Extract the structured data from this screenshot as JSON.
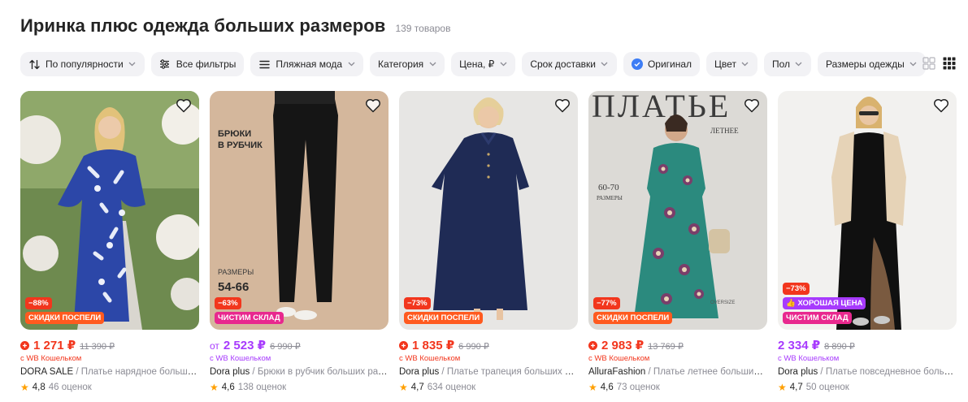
{
  "header": {
    "title": "Иринка плюс одежда больших размеров",
    "count": "139 товаров"
  },
  "filters": [
    {
      "label": "По популярности",
      "icon": "sort-icon",
      "chevron": true
    },
    {
      "label": "Все фильтры",
      "icon": "filters-icon",
      "chevron": false
    },
    {
      "label": "Пляжная мода",
      "icon": "menu-icon",
      "chevron": true
    },
    {
      "label": "Категория",
      "icon": "",
      "chevron": true
    },
    {
      "label": "Цена, ₽",
      "icon": "",
      "chevron": true
    },
    {
      "label": "Срок доставки",
      "icon": "",
      "chevron": true
    },
    {
      "label": "Оригинал",
      "icon": "check-icon",
      "chevron": false
    },
    {
      "label": "Цвет",
      "icon": "",
      "chevron": true
    },
    {
      "label": "Пол",
      "icon": "",
      "chevron": true
    },
    {
      "label": "Размеры одежды",
      "icon": "",
      "chevron": true
    }
  ],
  "colors": {
    "accent_red": "#f2361d",
    "accent_purple": "#a73afd",
    "chip_bg": "#f2f2f5",
    "star": "#ff9f00"
  },
  "products": [
    {
      "discount": "−88%",
      "badge": "СКИДКИ ПОСПЕЛИ",
      "badge_kind": "orange",
      "price_prefix": "",
      "price": "1 271 ₽",
      "old_price": "11 390 ₽",
      "wallet": "с WB Кошельком",
      "brand": "DORA SALE",
      "title": "Платье нарядное большого размера",
      "rating": "4,8",
      "reviews": "46 оценок",
      "image_overlay": "",
      "image_size_label": "",
      "image_sizes": ""
    },
    {
      "discount": "−63%",
      "badge": "ЧИСТИМ СКЛАД",
      "badge_kind": "pink",
      "price_prefix": "от",
      "price": "2 523 ₽",
      "old_price": "6 990 ₽",
      "wallet": "с WB Кошельком",
      "brand": "Dora plus",
      "title": "Брюки в рубчик больших размеров",
      "rating": "4,6",
      "reviews": "138 оценок",
      "image_overlay": "БРЮКИ В РУБЧИК",
      "image_size_label": "РАЗМЕРЫ",
      "image_sizes": "54-66"
    },
    {
      "discount": "−73%",
      "badge": "СКИДКИ ПОСПЕЛИ",
      "badge_kind": "orange",
      "price_prefix": "",
      "price": "1 835 ₽",
      "old_price": "6 990 ₽",
      "wallet": "с WB Кошельком",
      "brand": "Dora plus",
      "title": "Платье трапеция больших размеров",
      "rating": "4,7",
      "reviews": "634 оценок",
      "image_overlay": "",
      "image_size_label": "",
      "image_sizes": ""
    },
    {
      "discount": "−77%",
      "badge": "СКИДКИ ПОСПЕЛИ",
      "badge_kind": "orange",
      "price_prefix": "",
      "price": "2 983 ₽",
      "old_price": "13 769 ₽",
      "wallet": "с WB Кошельком",
      "brand": "AlluraFashion",
      "title": "Платье летнее больших размеров",
      "rating": "4,6",
      "reviews": "73 оценок",
      "image_overlay": "ПЛАТЬЕ",
      "image_overlay_sub": "ЛЕТНЕЕ",
      "image_size_label": "РАЗМЕРЫ",
      "image_sizes": "60-70"
    },
    {
      "discount": "−73%",
      "badge": "ХОРОШАЯ ЦЕНА",
      "badge_kind": "purple",
      "badge2": "ЧИСТИМ СКЛАД",
      "price_prefix": "",
      "price": "2 334 ₽",
      "old_price": "8 890 ₽",
      "wallet": "с WB Кошельком",
      "brand": "Dora plus",
      "title": "Платье повседневное большого размера",
      "rating": "4,7",
      "reviews": "50 оценок",
      "image_overlay": "",
      "image_size_label": "",
      "image_sizes": ""
    }
  ]
}
